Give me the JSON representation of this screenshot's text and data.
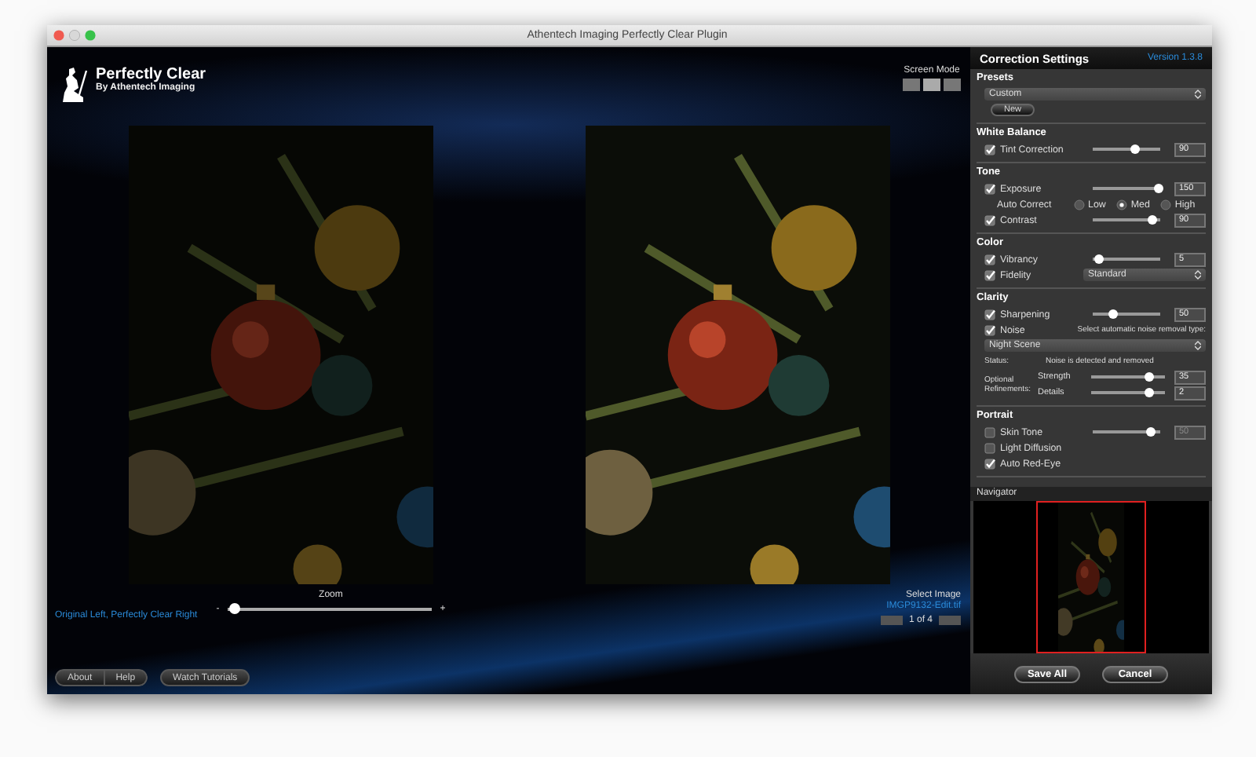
{
  "window": {
    "title": "Athentech Imaging Perfectly Clear Plugin"
  },
  "brand": {
    "name": "Perfectly Clear",
    "tagline": "By Athentech Imaging"
  },
  "screen_mode": {
    "label": "Screen Mode"
  },
  "preview": {
    "caption": "Original Left, Perfectly Clear Right",
    "zoom_label": "Zoom",
    "zoom_minus": "-",
    "zoom_plus": "+",
    "zoom_level": {
      "level": 0.03
    }
  },
  "image_select": {
    "label": "Select Image",
    "file": "IMGP9132-Edit.tif",
    "counter": "1 of 4"
  },
  "footer_buttons": [
    "About",
    "Help",
    "Watch Tutorials"
  ],
  "panel": {
    "title": "Correction Settings",
    "version": "Version 1.3.8",
    "sections": [
      {
        "title": "Presets",
        "rows": [
          {
            "kind": "dropdown",
            "value": "Custom"
          },
          {
            "kind": "button",
            "label": "New"
          }
        ]
      },
      {
        "title": "White Balance",
        "rows": [
          {
            "kind": "slider",
            "label": "Tint Correction",
            "checked": true,
            "level": 0.62,
            "value": "90"
          }
        ]
      },
      {
        "title": "Tone",
        "rows": [
          {
            "kind": "slider",
            "label": "Exposure",
            "checked": true,
            "level": 0.98,
            "value": "150"
          },
          {
            "kind": "radio",
            "label": "Auto Correct",
            "options": [
              {
                "label": "Low",
                "selected": false
              },
              {
                "label": "Med",
                "selected": true
              },
              {
                "label": "High",
                "selected": false
              }
            ]
          },
          {
            "kind": "slider",
            "label": "Contrast",
            "checked": true,
            "level": 0.88,
            "value": "90"
          }
        ]
      },
      {
        "title": "Color",
        "rows": [
          {
            "kind": "slider",
            "label": "Vibrancy",
            "checked": true,
            "level": 0.1,
            "value": "5"
          },
          {
            "kind": "select",
            "label": "Fidelity",
            "checked": true,
            "value": "Standard"
          }
        ]
      },
      {
        "title": "Clarity",
        "rows": [
          {
            "kind": "slider",
            "label": "Sharpening",
            "checked": true,
            "level": 0.3,
            "value": "50"
          },
          {
            "kind": "check",
            "label": "Noise",
            "checked": true,
            "note": "Select automatic noise removal type:"
          },
          {
            "kind": "dropdown",
            "value": "Night Scene"
          },
          {
            "kind": "status",
            "label": "Status:",
            "text": "Noise is detected and removed"
          },
          {
            "kind": "refine",
            "label": "Optional Refinements:",
            "items": [
              {
                "label": "Strength",
                "level": 0.78,
                "value": "35"
              },
              {
                "label": "Details",
                "level": 0.78,
                "value": "2"
              }
            ]
          }
        ]
      },
      {
        "title": "Portrait",
        "rows": [
          {
            "kind": "slider",
            "label": "Skin Tone",
            "checked": false,
            "level": 0.85,
            "value": "50"
          },
          {
            "kind": "check",
            "label": "Light Diffusion",
            "checked": false
          },
          {
            "kind": "check",
            "label": "Auto Red-Eye",
            "checked": true
          }
        ]
      }
    ]
  },
  "navigator": {
    "title": "Navigator"
  },
  "actions": [
    "Save All",
    "Cancel"
  ]
}
